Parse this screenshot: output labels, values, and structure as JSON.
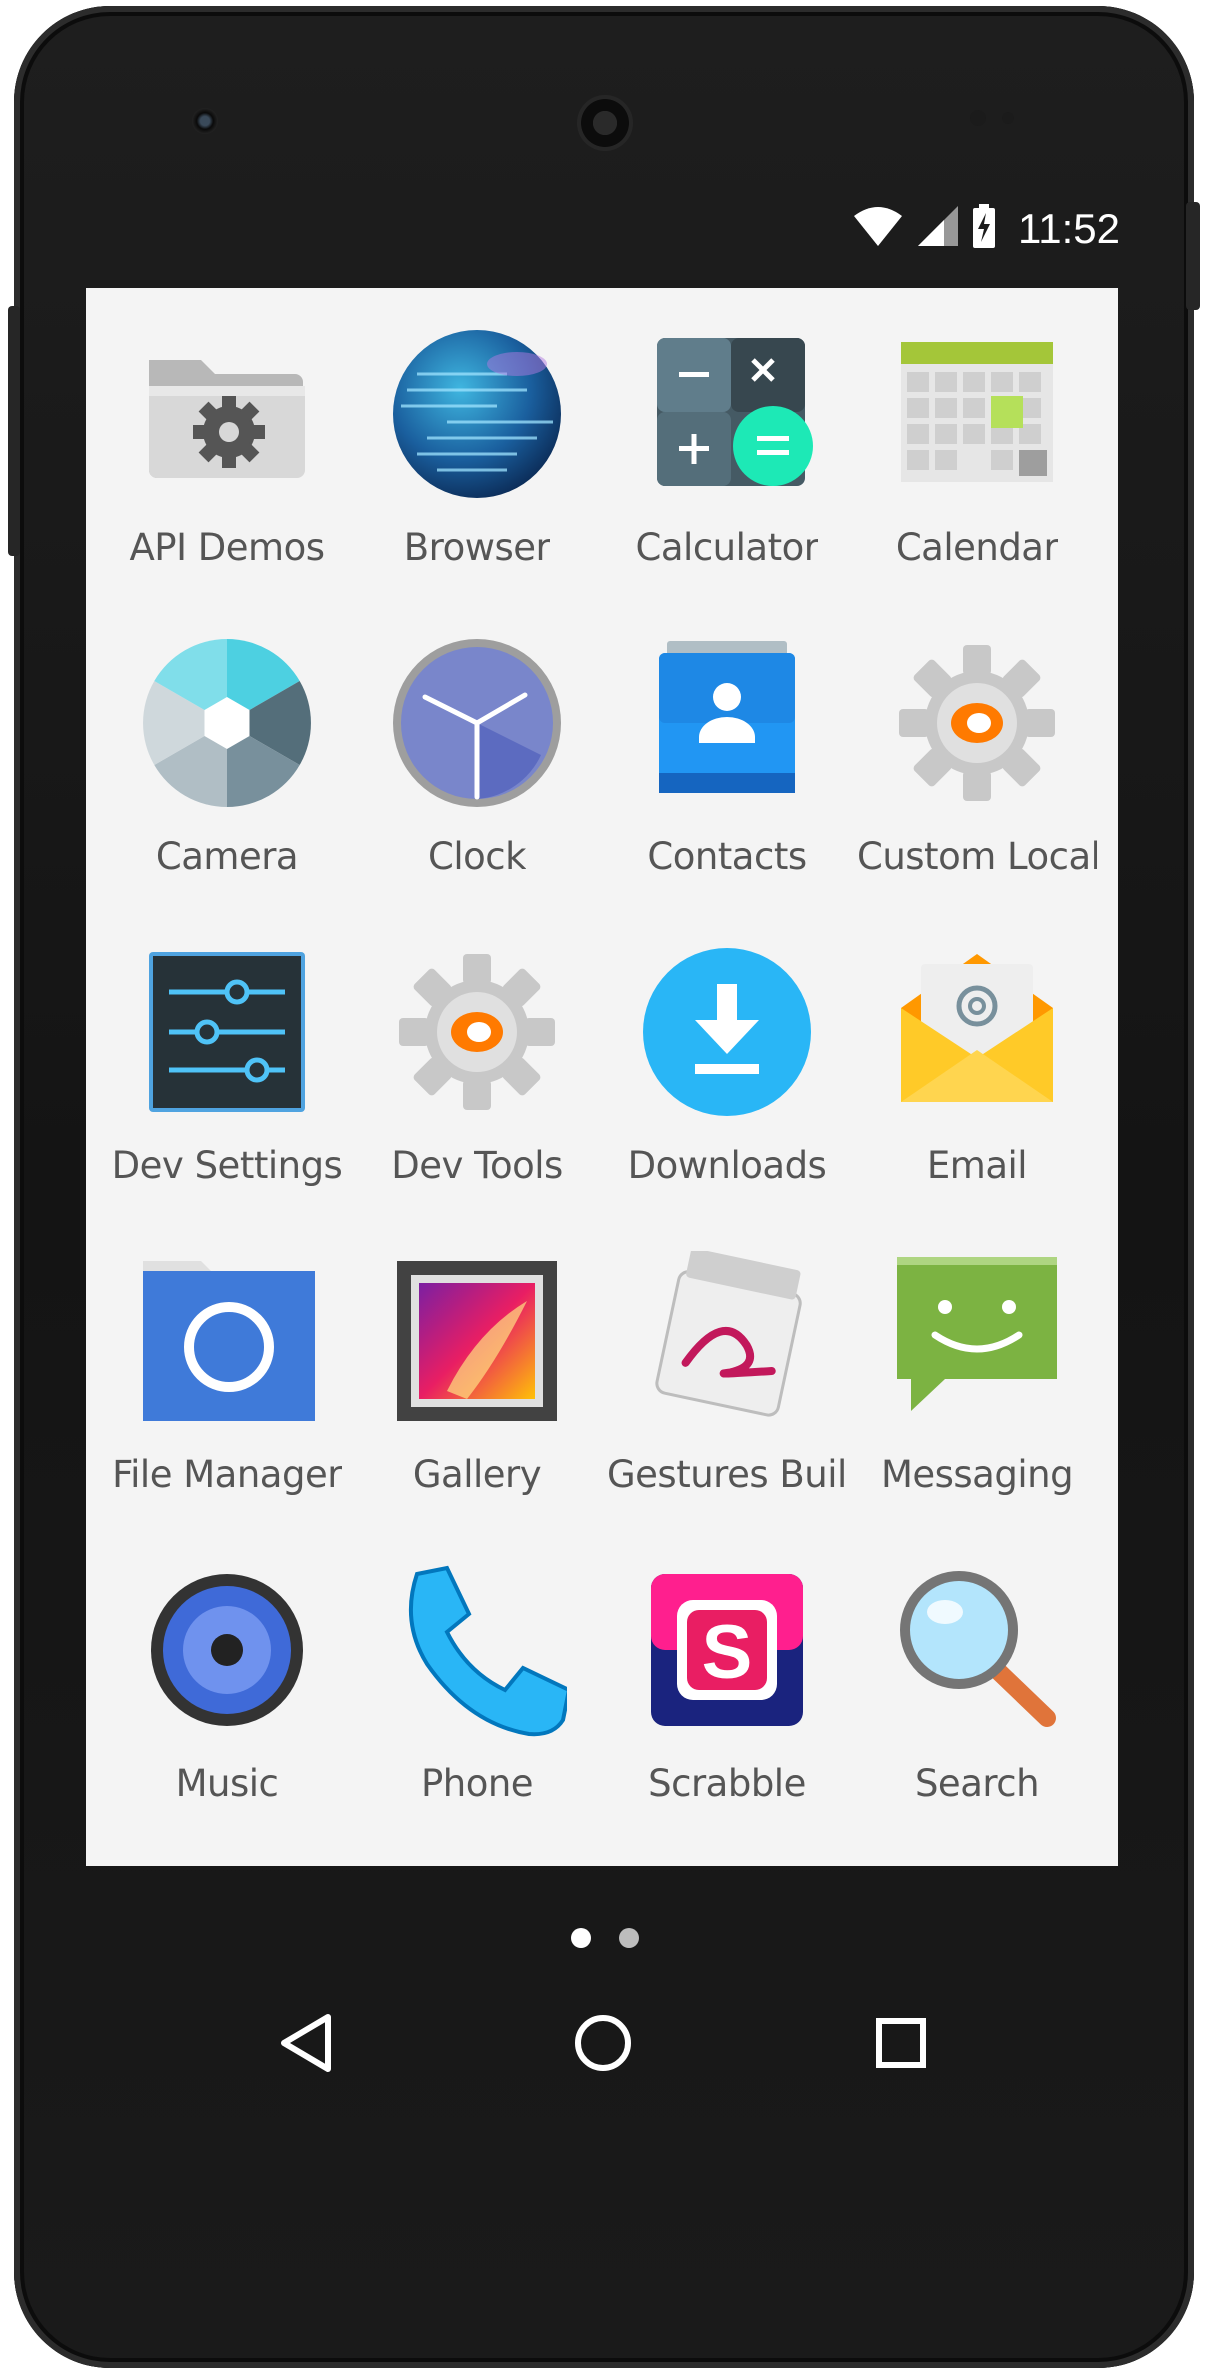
{
  "status_bar": {
    "time": "11:52"
  },
  "apps": [
    {
      "label": "API Demos",
      "icon": "api-demos-folder-icon"
    },
    {
      "label": "Browser",
      "icon": "browser-globe-icon"
    },
    {
      "label": "Calculator",
      "icon": "calculator-icon"
    },
    {
      "label": "Calendar",
      "icon": "calendar-icon"
    },
    {
      "label": "Camera",
      "icon": "camera-shutter-icon"
    },
    {
      "label": "Clock",
      "icon": "clock-icon"
    },
    {
      "label": "Contacts",
      "icon": "contacts-icon"
    },
    {
      "label": "Custom Locale",
      "icon": "custom-locale-gear-icon"
    },
    {
      "label": "Dev Settings",
      "icon": "dev-settings-sliders-icon"
    },
    {
      "label": "Dev Tools",
      "icon": "dev-tools-gear-icon"
    },
    {
      "label": "Downloads",
      "icon": "downloads-icon"
    },
    {
      "label": "Email",
      "icon": "email-envelope-icon"
    },
    {
      "label": "File Manager",
      "icon": "file-manager-folder-icon"
    },
    {
      "label": "Gallery",
      "icon": "gallery-picture-icon"
    },
    {
      "label": "Gestures Buil…",
      "icon": "gestures-builder-icon"
    },
    {
      "label": "Messaging",
      "icon": "messaging-icon"
    },
    {
      "label": "Music",
      "icon": "music-speaker-icon"
    },
    {
      "label": "Phone",
      "icon": "phone-handset-icon"
    },
    {
      "label": "Scrabble",
      "icon": "scrabble-icon"
    },
    {
      "label": "Search",
      "icon": "search-magnifier-icon"
    }
  ],
  "page_indicator": {
    "pages": 2,
    "current": 1
  },
  "nav_bar": {
    "back": "back-triangle-icon",
    "home": "home-circle-icon",
    "recents": "recents-square-icon"
  },
  "colors": {
    "screen_bg": "#f4f4f4",
    "label_text": "#555555",
    "phone_body": "#1a1a1a",
    "dot_active": "#ffffff",
    "dot_inactive": "#bdbdbd"
  }
}
